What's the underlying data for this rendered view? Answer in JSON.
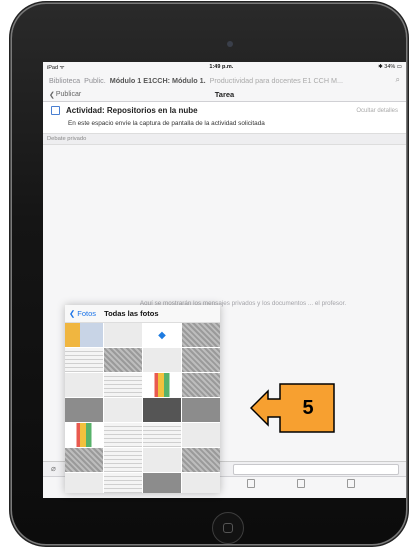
{
  "statusbar": {
    "left": "iPad ᯤ",
    "center": "1:49 p.m.",
    "right": "✱ 34% ▭"
  },
  "breadcrumb": {
    "items": [
      "Biblioteca",
      "Public.",
      "Módulo 1 E1CCH: Módulo 1.",
      "Productividad para docentes E1 CCH M..."
    ],
    "search_icon": "search-icon"
  },
  "navbar": {
    "back_label": "Publicar",
    "title": "Tarea"
  },
  "task": {
    "title": "Actividad: Repositorios en la nube",
    "hide_details": "Ocultar detalles",
    "description": "En este espacio envíe la captura de pantalla de la actividad solicitada"
  },
  "private_header": "Debate privado",
  "empty_message": "Aquí se mostrarán los mensajes privados y los documentos ... el profesor.",
  "tabbar": {
    "tabs": [
      "",
      "",
      "",
      "",
      ""
    ]
  },
  "picker": {
    "back_label": "Fotos",
    "title": "Todas las fotos"
  },
  "callout": {
    "number": "5",
    "color": "#f7a030"
  },
  "colors": {
    "accent": "#1a73e8",
    "checkbox": "#4a7fd1"
  }
}
